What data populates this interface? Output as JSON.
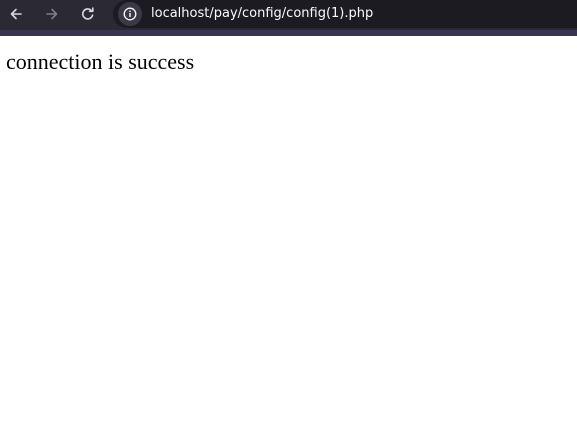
{
  "browser": {
    "url": "localhost/pay/config/config(1).php",
    "toolbar_color": "#2b2a33",
    "address_bar_color": "#1c1b22",
    "nav_buttons": {
      "back_icon": "arrow-left-icon",
      "forward_icon": "arrow-right-icon",
      "reload_icon": "reload-icon",
      "site_info_icon": "info-circle-icon"
    }
  },
  "page": {
    "message": "connection is success"
  }
}
